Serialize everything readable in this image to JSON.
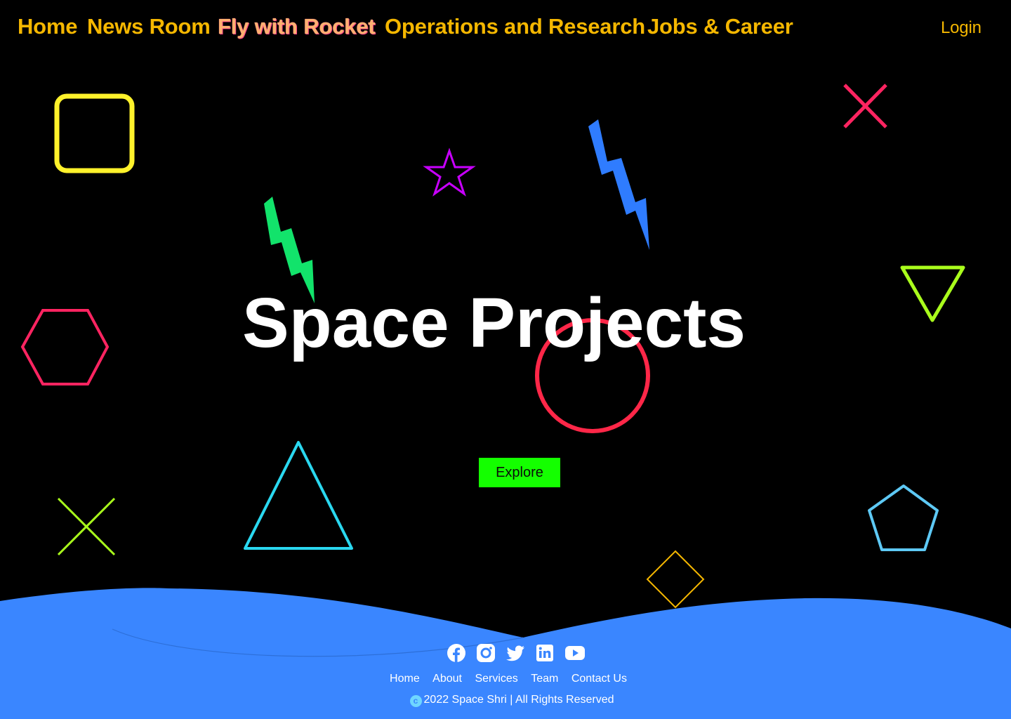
{
  "nav": {
    "items": [
      {
        "label": "Home"
      },
      {
        "label": "News Room"
      },
      {
        "label": "Fly with Rocket"
      },
      {
        "label": "Operations and Research"
      },
      {
        "label": "Jobs & Career"
      }
    ],
    "login_label": "Login"
  },
  "hero": {
    "title": "Space Projects",
    "button_label": "Explore"
  },
  "footer": {
    "social_icons": [
      "facebook-icon",
      "instagram-icon",
      "twitter-icon",
      "linkedin-icon",
      "youtube-icon"
    ],
    "links": [
      "Home",
      "About",
      "Services",
      "Team",
      "Contact Us"
    ],
    "copyright_symbol": "c",
    "copyright": "2022 Space Shri | All Rights Reserved"
  },
  "colors": {
    "background": "#000000",
    "nav_text": "#f5b700",
    "nav_active": "#ffb070",
    "explore_button": "#14ff00",
    "footer": "#3a86ff"
  }
}
